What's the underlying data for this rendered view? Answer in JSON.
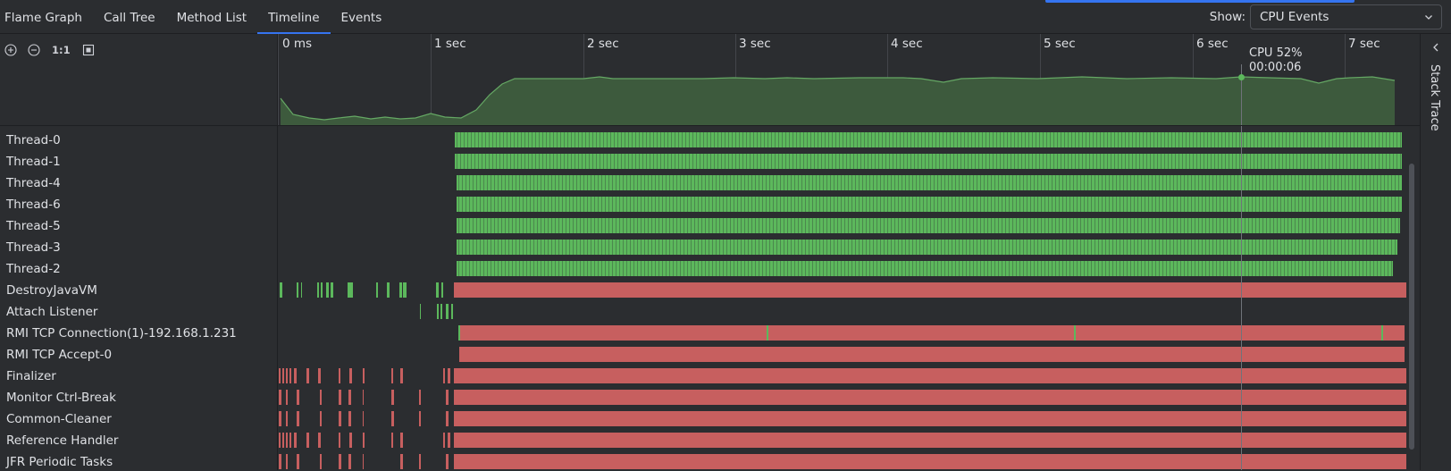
{
  "tabs": [
    {
      "label": "Flame Graph",
      "active": false
    },
    {
      "label": "Call Tree",
      "active": false
    },
    {
      "label": "Method List",
      "active": false
    },
    {
      "label": "Timeline",
      "active": true
    },
    {
      "label": "Events",
      "active": false
    }
  ],
  "show": {
    "label": "Show:",
    "value": "CPU Events"
  },
  "toolbar": {
    "one_to_one": "1:1"
  },
  "ruler": {
    "ticks": [
      "0 ms",
      "1 sec",
      "2 sec",
      "3 sec",
      "4 sec",
      "5 sec",
      "6 sec",
      "7 sec"
    ]
  },
  "tooltip": {
    "cpu": "CPU 52%",
    "time": "00:00:06"
  },
  "threads": [
    "Thread-0",
    "Thread-1",
    "Thread-4",
    "Thread-6",
    "Thread-5",
    "Thread-3",
    "Thread-2",
    "DestroyJavaVM",
    "Attach Listener",
    "RMI TCP Connection(1)-192.168.1.231",
    "RMI TCP Accept-0",
    "Finalizer",
    "Monitor Ctrl-Break",
    "Common-Cleaner",
    "Reference Handler",
    "JFR Periodic Tasks"
  ],
  "right_panel": {
    "label": "Stack Trace"
  },
  "colors": {
    "running": "#5cb85c",
    "waiting": "#c75f5f",
    "cpu_fill": "#3d5a3d",
    "cpu_line": "#65a864",
    "accent": "#3574f0"
  }
}
